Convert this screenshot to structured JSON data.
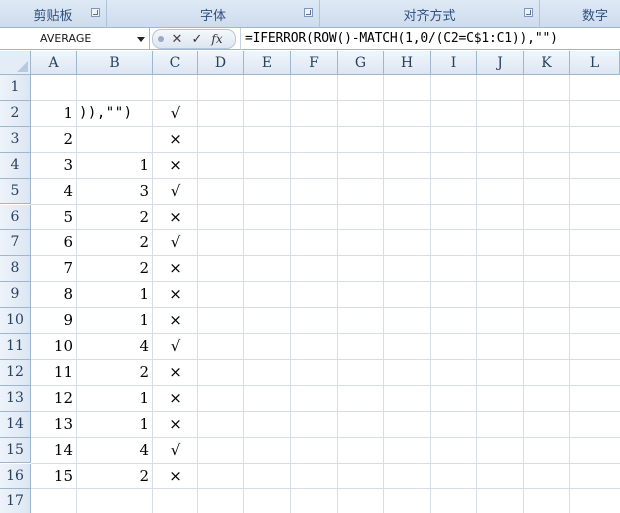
{
  "ribbon": {
    "groups": [
      {
        "label": "剪贴板",
        "has_launcher": true
      },
      {
        "label": "字体",
        "has_launcher": true
      },
      {
        "label": "对齐方式",
        "has_launcher": true
      },
      {
        "label": "数字",
        "has_launcher": false
      }
    ]
  },
  "formula_bar": {
    "name_box": "AVERAGE",
    "cancel_symbol": "✕",
    "enter_symbol": "✓",
    "fx_label": "fx",
    "formula": "=IFERROR(ROW()-MATCH(1,0/(C2=C$1:C1)),\"\")"
  },
  "columns": [
    "A",
    "B",
    "C",
    "D",
    "E",
    "F",
    "G",
    "H",
    "I",
    "J",
    "K",
    "L"
  ],
  "rows": [
    "1",
    "2",
    "3",
    "4",
    "5",
    "6",
    "7",
    "8",
    "9",
    "10",
    "11",
    "12",
    "13",
    "14",
    "15",
    "16",
    "17"
  ],
  "sheet": {
    "col_a": [
      "",
      "1",
      "2",
      "3",
      "4",
      "5",
      "6",
      "7",
      "8",
      "9",
      "10",
      "11",
      "12",
      "13",
      "14",
      "15",
      ""
    ],
    "col_b": [
      "",
      ")),\"\")",
      "",
      "1",
      "3",
      "2",
      "2",
      "2",
      "1",
      "1",
      "4",
      "2",
      "1",
      "1",
      "4",
      "2",
      ""
    ],
    "col_c": [
      "",
      "√",
      "×",
      "×",
      "√",
      "×",
      "√",
      "×",
      "×",
      "×",
      "√",
      "×",
      "×",
      "×",
      "√",
      "×",
      ""
    ]
  }
}
